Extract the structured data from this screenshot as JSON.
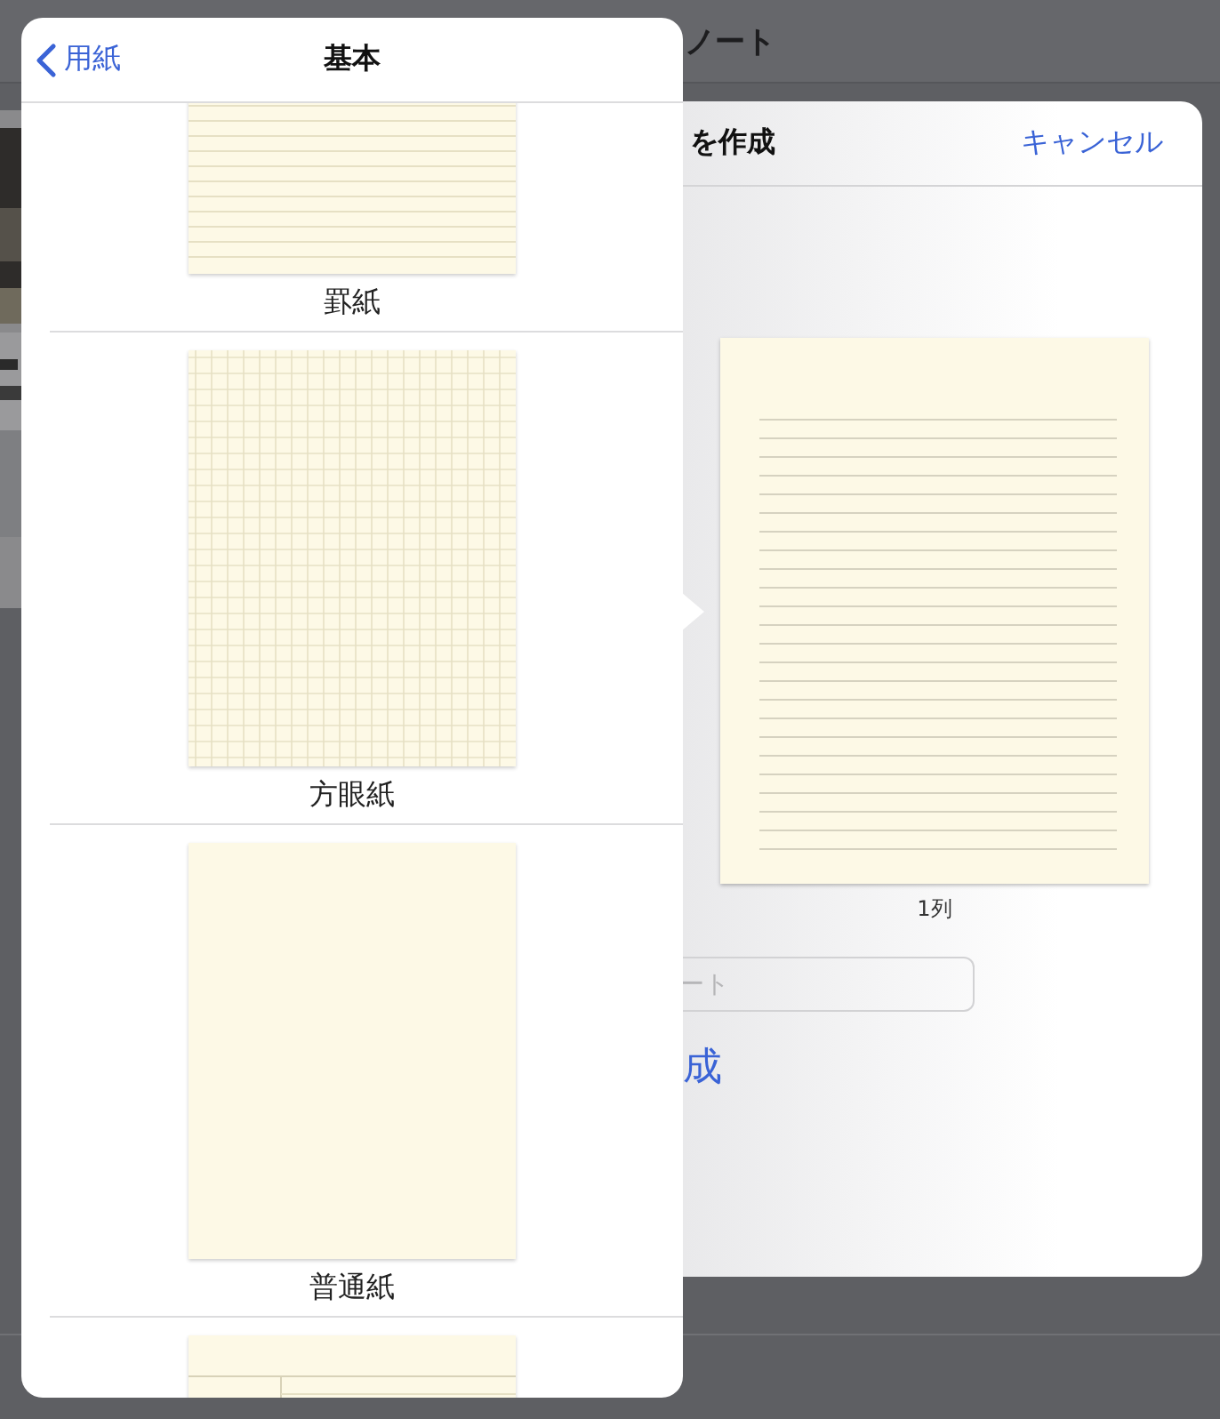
{
  "background": {
    "title": "ノート"
  },
  "sheet": {
    "title": "を作成",
    "cancel": "キャンセル",
    "preview": {
      "kind": "ruled",
      "caption": "1列"
    },
    "name_field": {
      "placeholder": "ート"
    },
    "create_button": "成"
  },
  "popover": {
    "back": "用紙",
    "title": "基本",
    "papers": [
      {
        "kind": "ruled",
        "label": "罫紙"
      },
      {
        "kind": "grid",
        "label": "方眼紙"
      },
      {
        "kind": "plain",
        "label": "普通紙"
      },
      {
        "kind": "cornell"
      }
    ]
  }
}
